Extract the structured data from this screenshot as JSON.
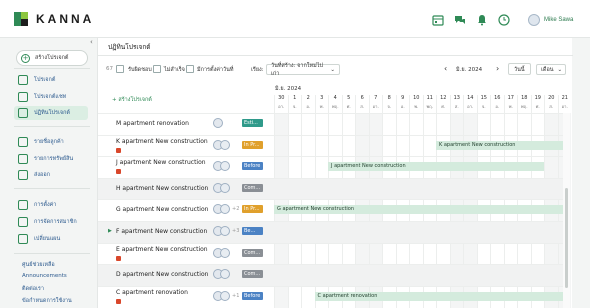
{
  "app": {
    "logo_text": "KANNA",
    "brand_green": "#2f8a56",
    "brand_red": "#d9472b"
  },
  "topbar": {
    "icons": [
      "calendar-icon",
      "chat-icon",
      "bell-icon",
      "clock-icon"
    ],
    "user_name": "Mike Sawa"
  },
  "sidebar": {
    "create_label": "สร้างโปรเจกต์",
    "groups": [
      [
        {
          "label": "โปรเจกต์",
          "icon": "table-icon"
        },
        {
          "label": "โปรเจกต์แชท",
          "icon": "list-icon"
        },
        {
          "label": "ปฏิทินโปรเจกต์",
          "icon": "calendar-icon",
          "active": true
        }
      ],
      [
        {
          "label": "รายชื่อลูกค้า",
          "icon": "user-icon"
        },
        {
          "label": "รายการทรัพย์สิน",
          "icon": "box-icon"
        },
        {
          "label": "ส่งออก",
          "icon": "export-icon"
        }
      ],
      [
        {
          "label": "การตั้งค่า",
          "icon": "gear-icon"
        },
        {
          "label": "การจัดการสมาชิก",
          "icon": "members-icon"
        },
        {
          "label": "เปลี่ยนแผน",
          "icon": "plan-icon"
        }
      ]
    ],
    "footer_links": [
      "ศูนย์ช่วยเหลือ",
      "Announcements",
      "ติดต่อเรา",
      "ข้อกำหนดการใช้งาน"
    ]
  },
  "main": {
    "title": "ปฏิทินโปรเจกต์",
    "toolbar": {
      "count": "67",
      "filter1": "รับผิดชอบ",
      "filter2": "ไม่สำเร็จ",
      "filter3": "มีการตั้งค่าวันที่",
      "sort_label": "เรียง:",
      "sort_value": "วันที่สร้าง: จากใหม่ไปเก่า",
      "month": "มิ.ย. 2024",
      "today_label": "วันนี้",
      "view_value": "เดือน"
    },
    "add_project_label": "สร้างโปรเจกต์",
    "month_header": "มิ.ย. 2024",
    "days": [
      {
        "d": "30",
        "w": "อา."
      },
      {
        "d": "1",
        "w": "จ."
      },
      {
        "d": "2",
        "w": "อ."
      },
      {
        "d": "3",
        "w": "พ."
      },
      {
        "d": "4",
        "w": "พฤ."
      },
      {
        "d": "5",
        "w": "ศ."
      },
      {
        "d": "6",
        "w": "ส."
      },
      {
        "d": "7",
        "w": "อา."
      },
      {
        "d": "8",
        "w": "จ."
      },
      {
        "d": "9",
        "w": "อ."
      },
      {
        "d": "10",
        "w": "พ."
      },
      {
        "d": "11",
        "w": "พฤ."
      },
      {
        "d": "12",
        "w": "ศ."
      },
      {
        "d": "13",
        "w": "ส."
      },
      {
        "d": "14",
        "w": "อา."
      },
      {
        "d": "15",
        "w": "จ."
      },
      {
        "d": "16",
        "w": "อ."
      },
      {
        "d": "17",
        "w": "พ."
      },
      {
        "d": "18",
        "w": "พฤ."
      },
      {
        "d": "19",
        "w": "ศ."
      },
      {
        "d": "20",
        "w": "ส."
      },
      {
        "d": "21",
        "w": "อา."
      }
    ],
    "rows": [
      {
        "name": "M apartment renovation",
        "status": "Esti...",
        "status_color": "#2f9a8a",
        "warn": false,
        "more": "",
        "bar": null
      },
      {
        "name": "K apartment New construction",
        "status": "In Pr...",
        "status_color": "#e0a02c",
        "warn": true,
        "more": "",
        "bar": {
          "label": "K apartment New construction",
          "start": 12,
          "end": 22
        }
      },
      {
        "name": "J apartment New construction",
        "status": "Before",
        "status_color": "#4b82c4",
        "warn": true,
        "more": "",
        "bar": {
          "label": "J apartment New construction",
          "start": 4,
          "end": 20
        }
      },
      {
        "name": "H apartment New construction",
        "status": "Com...",
        "status_color": "#8a8f95",
        "warn": false,
        "more": "",
        "bar": null
      },
      {
        "name": "G apartment New construction",
        "status": "In Pr...",
        "status_color": "#e0a02c",
        "warn": false,
        "more": "+2",
        "bar": {
          "label": "G apartment New construction",
          "start": 0,
          "end": 22
        }
      },
      {
        "name": "F apartment New construction",
        "status": "Be...",
        "status_color": "#4b82c4",
        "warn": false,
        "more": "+3",
        "bar": null
      },
      {
        "name": "E apartment New construction",
        "status": "Com...",
        "status_color": "#8a8f95",
        "warn": true,
        "more": "",
        "bar": null
      },
      {
        "name": "D apartment New construction",
        "status": "Com...",
        "status_color": "#8a8f95",
        "warn": false,
        "more": "",
        "bar": null
      },
      {
        "name": "C apartment renovation",
        "status": "Before",
        "status_color": "#4b82c4",
        "warn": true,
        "more": "+1",
        "bar": {
          "label": "C apartment renovation",
          "start": 3,
          "end": 22
        }
      }
    ]
  }
}
